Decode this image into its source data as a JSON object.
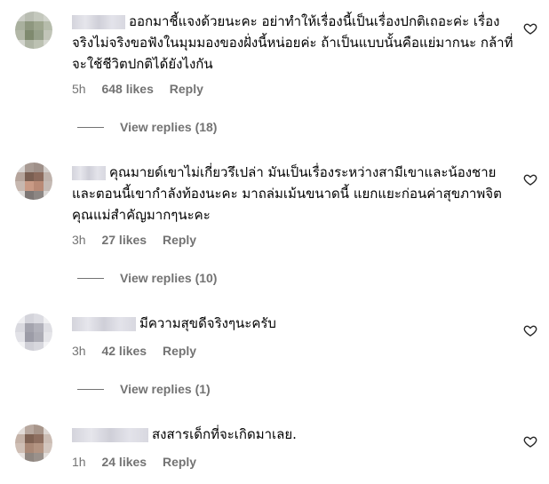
{
  "comments": [
    {
      "text": "ออกมาชี้แจงด้วยนะคะ อย่าทำให้เรื่องนี้เป็นเรื่องปกติเถอะค่ะ เรื่องจริงไม่จริงขอฟังในมุมมองของฝั่งนี้หน่อยค่ะ ถ้าเป็นแบบนั้นคือแย่มากนะ กล้าที่จะใช้ชีวิตปกติได้ยังไงกัน",
      "time": "5h",
      "likes": "648 likes",
      "reply": "Reply",
      "view_replies": "View replies (18)"
    },
    {
      "text": "คุณมายด์เขาไม่เกี่ยวรึเปล่า มันเป็นเรื่องระหว่างสามีเขาและน้องชาย และตอนนี้เขากำลังท้องนะคะ มาถล่มเม้นขนาดนี้ แยกแยะก่อนค่าสุขภาพจิตคุณแม่สำคัญมากๆนะคะ",
      "time": "3h",
      "likes": "27 likes",
      "reply": "Reply",
      "view_replies": "View replies (10)"
    },
    {
      "text": "มีความสุขดีจริงๆนะครับ",
      "time": "3h",
      "likes": "42 likes",
      "reply": "Reply",
      "view_replies": "View replies (1)"
    },
    {
      "text": "สงสารเด็กที่จะเกิดมาเลย.",
      "time": "1h",
      "likes": "24 likes",
      "reply": "Reply"
    }
  ],
  "icons": {
    "like": "heart-outline-icon"
  },
  "colors": {
    "meta": "#737373",
    "text": "#000000",
    "background": "#ffffff"
  }
}
